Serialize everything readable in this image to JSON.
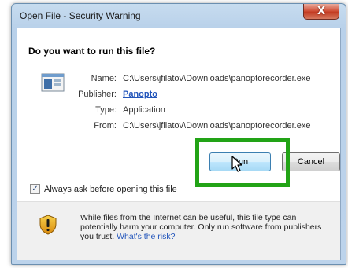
{
  "window": {
    "title": "Open File - Security Warning",
    "close_glyph": "X"
  },
  "dialog": {
    "heading": "Do you want to run this file?",
    "fields": [
      {
        "label": "Name:",
        "value": "C:\\Users\\jfilatov\\Downloads\\panoptorecorder.exe"
      },
      {
        "label": "Publisher:",
        "value": "Panopto"
      },
      {
        "label": "Type:",
        "value": "Application"
      },
      {
        "label": "From:",
        "value": "C:\\Users\\jfilatov\\Downloads\\panoptorecorder.exe"
      }
    ],
    "buttons": {
      "run": "Run",
      "cancel": "Cancel"
    },
    "checkbox": {
      "label": "Always ask before opening this file",
      "checked": true,
      "check_glyph": "✓"
    },
    "warning": {
      "text": "While files from the Internet can be useful, this file type can potentially harm your computer. Only run software from publishers you trust.",
      "link": "What's the risk?"
    }
  },
  "colors": {
    "highlight": "#22a316",
    "link": "#2255bb"
  },
  "icons": {
    "file": "application-file-icon",
    "warning": "warning-shield-icon",
    "cursor": "mouse-pointer-icon"
  }
}
